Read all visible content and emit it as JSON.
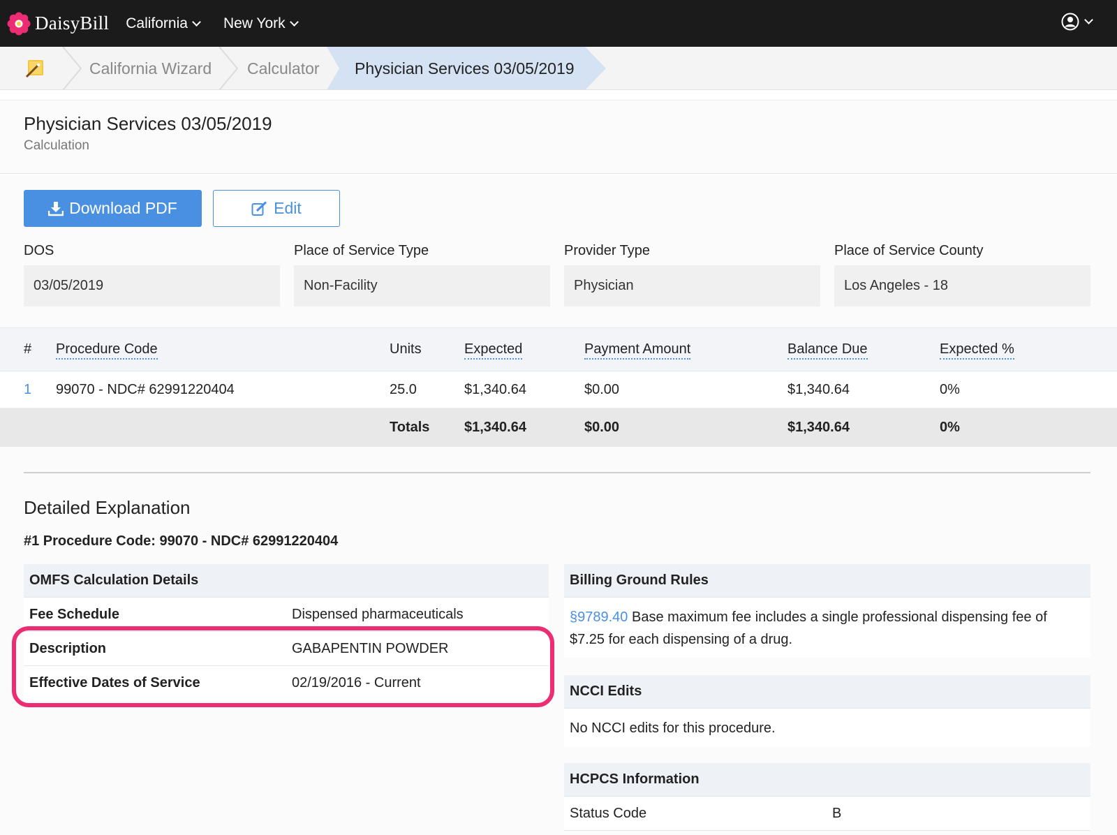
{
  "navbar": {
    "brand": "DaisyBill",
    "menus": [
      "California",
      "New York"
    ],
    "user_icon": "user-circle-icon",
    "brand_color": "#ec2d74"
  },
  "breadcrumb": {
    "home_icon": "wand-icon",
    "items": [
      "California Wizard",
      "Calculator",
      "Physician Services 03/05/2019"
    ]
  },
  "header": {
    "title": "Physician Services 03/05/2019",
    "subtitle": "Calculation"
  },
  "actions": {
    "download_label": "Download PDF",
    "edit_label": "Edit",
    "accent": "#4a90e2"
  },
  "fields": [
    {
      "label": "DOS",
      "value": "03/05/2019"
    },
    {
      "label": "Place of Service Type",
      "value": "Non-Facility"
    },
    {
      "label": "Provider Type",
      "value": "Physician"
    },
    {
      "label": "Place of Service County",
      "value": "Los Angeles - 18"
    }
  ],
  "procedures": {
    "columns": [
      "#",
      "Procedure Code",
      "Units",
      "Expected",
      "Payment Amount",
      "Balance Due",
      "Expected %"
    ],
    "rows": [
      {
        "num": "1",
        "code": "99070 - NDC# 62991220404",
        "units": "25.0",
        "expected": "$1,340.64",
        "payment": "$0.00",
        "balance": "$1,340.64",
        "pct": "0%"
      }
    ],
    "totals": {
      "label": "Totals",
      "expected": "$1,340.64",
      "payment": "$0.00",
      "balance": "$1,340.64",
      "pct": "0%"
    }
  },
  "detail": {
    "title": "Detailed Explanation",
    "procedure_heading": "#1 Procedure Code: 99070 - NDC# 62991220404",
    "omfs": {
      "heading": "OMFS Calculation Details",
      "rows": [
        {
          "key": "Fee Schedule",
          "value": "Dispensed pharmaceuticals"
        },
        {
          "key": "Description",
          "value": "GABAPENTIN POWDER"
        },
        {
          "key": "Effective Dates of Service",
          "value": "02/19/2016 - Current"
        }
      ]
    },
    "ground_rules": {
      "heading": "Billing Ground Rules",
      "link": "§9789.40",
      "text": " Base maximum fee includes a single professional dispensing fee of $7.25 for each dispensing of a drug."
    },
    "ncci": {
      "heading": "NCCI Edits",
      "text": "No NCCI edits for this procedure."
    },
    "hcpcs": {
      "heading": "HCPCS Information",
      "rows": [
        {
          "key": "Status Code",
          "value": "B"
        }
      ]
    }
  }
}
